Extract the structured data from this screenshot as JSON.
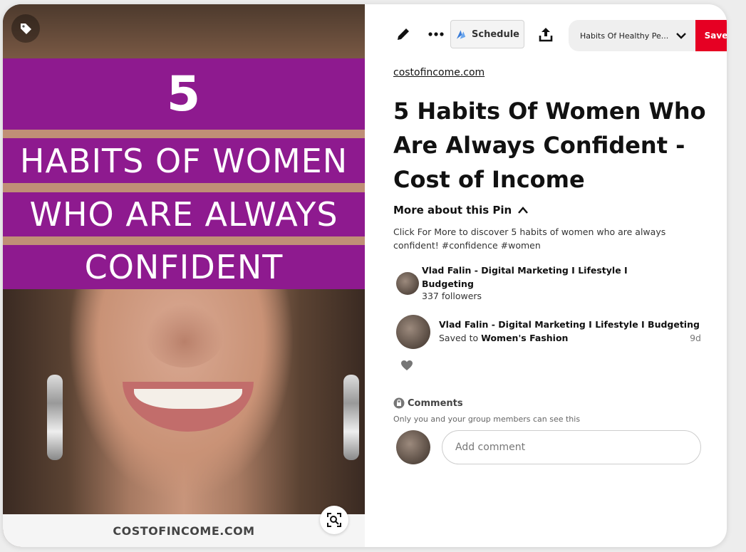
{
  "image": {
    "overlay_number": "5",
    "overlay_lines": [
      "HABITS OF WOMEN",
      "WHO ARE ALWAYS",
      "CONFIDENT"
    ],
    "footer_text": "COSTOFINCOME.COM",
    "band_color": "#8e1a8f"
  },
  "toolbar": {
    "edit_icon": "pencil-icon",
    "more_icon": "ellipsis-icon",
    "schedule_label": "Schedule",
    "share_icon": "share-icon",
    "board_name": "Habits Of Healthy Pe...",
    "save_label": "Save",
    "save_color": "#e60023"
  },
  "pin": {
    "source": "costofincome.com",
    "title": "5 Habits Of Women Who Are Always Confident - Cost of Income",
    "more_about_label": "More about this Pin",
    "description": "Click For More to discover 5 habits of women who are always confident! #confidence #women"
  },
  "creator": {
    "name": "Vlad Falin - Digital Marketing I Lifestyle I Budgeting",
    "followers": "337 followers"
  },
  "saved_by": {
    "name": "Vlad Falin - Digital Marketing I Lifestyle I Budgeting",
    "saved_to_prefix": "Saved to",
    "board": "Women's Fashion",
    "time": "9d"
  },
  "comments": {
    "heading": "Comments",
    "privacy_note": "Only you and your group members can see this",
    "placeholder": "Add comment"
  }
}
